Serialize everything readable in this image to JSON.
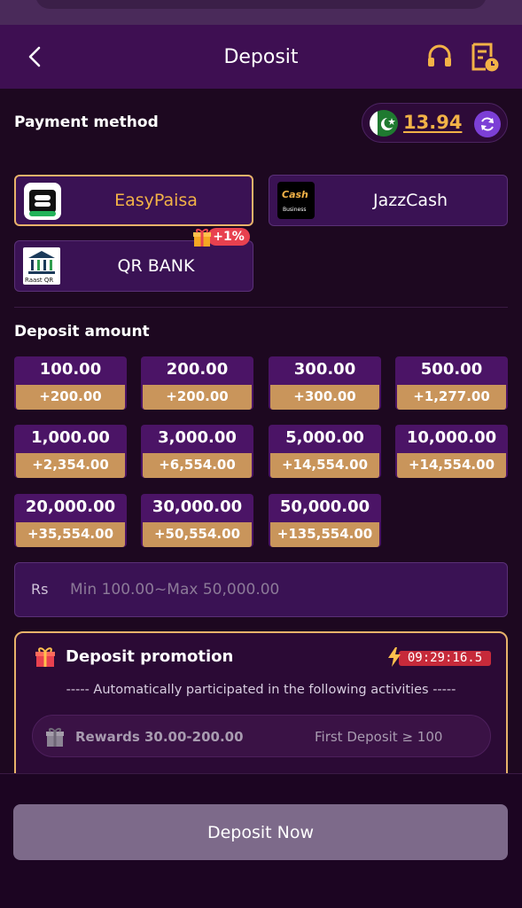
{
  "header": {
    "title": "Deposit"
  },
  "payment": {
    "title": "Payment method",
    "balance": "13.94",
    "methods": [
      {
        "label": "EasyPaisa",
        "selected": true
      },
      {
        "label": "JazzCash",
        "logo_text": "Cash",
        "logo_sub": "Business"
      },
      {
        "label": "QR BANK",
        "logo_text": "Raast QR",
        "badge": "+1%"
      }
    ]
  },
  "deposit_amount": {
    "title": "Deposit amount",
    "options": [
      {
        "value": "100.00",
        "bonus": "+200.00"
      },
      {
        "value": "200.00",
        "bonus": "+200.00"
      },
      {
        "value": "300.00",
        "bonus": "+300.00"
      },
      {
        "value": "500.00",
        "bonus": "+1,277.00"
      },
      {
        "value": "1,000.00",
        "bonus": "+2,354.00"
      },
      {
        "value": "3,000.00",
        "bonus": "+6,554.00"
      },
      {
        "value": "5,000.00",
        "bonus": "+14,554.00"
      },
      {
        "value": "10,000.00",
        "bonus": "+14,554.00"
      },
      {
        "value": "20,000.00",
        "bonus": "+35,554.00"
      },
      {
        "value": "30,000.00",
        "bonus": "+50,554.00"
      },
      {
        "value": "50,000.00",
        "bonus": "+135,554.00"
      }
    ],
    "currency": "Rs",
    "placeholder": "Min 100.00~Max 50,000.00"
  },
  "promotion": {
    "title": "Deposit promotion",
    "timer": "09:29:16.5",
    "note": "----- Automatically participated in the following activities -----",
    "items": [
      {
        "reward": "Rewards 30.00-200.00",
        "condition": "First Deposit ≥ 100"
      }
    ]
  },
  "footer": {
    "button": "Deposit Now"
  },
  "colors": {
    "background": "#1d0820",
    "header": "#3e0f52",
    "accent_gold": "#f2b247",
    "bonus_bar": "#c9955b",
    "button": "#7d6a8a"
  },
  "icons": {
    "back": "chevron-left-icon",
    "support": "headset-icon",
    "records": "deposit-record-icon",
    "refresh": "refresh-icon",
    "gift": "gift-icon",
    "timer": "lightning-icon"
  }
}
